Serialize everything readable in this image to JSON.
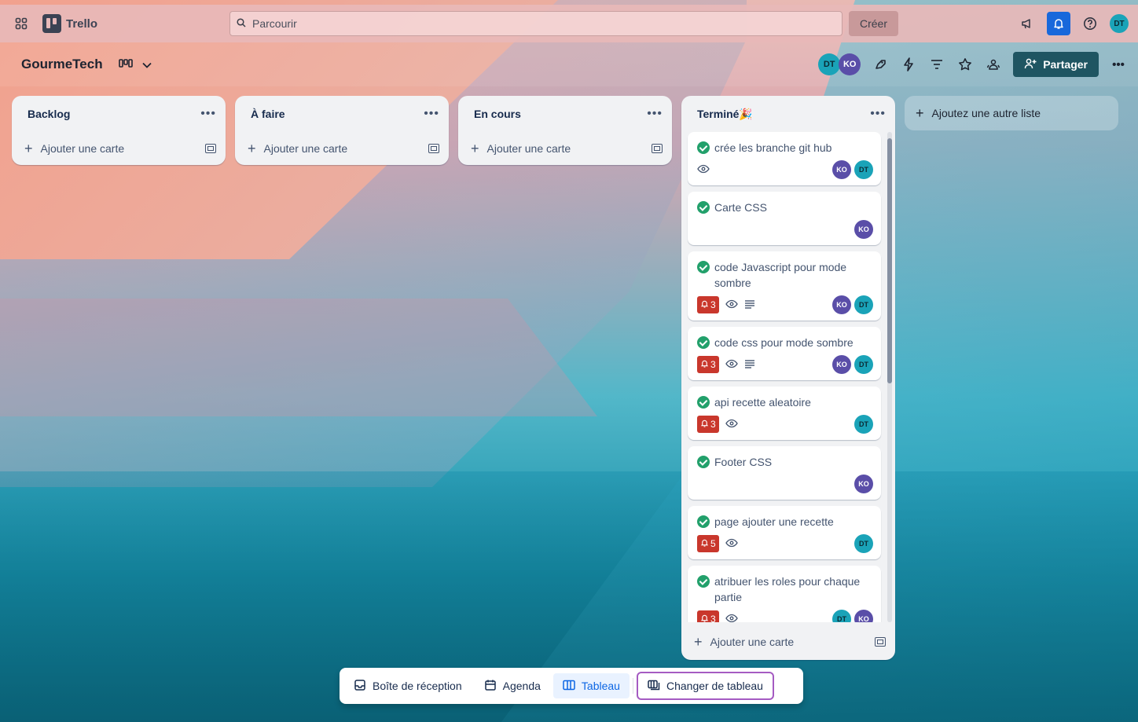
{
  "app": {
    "name": "Trello"
  },
  "topbar": {
    "search_placeholder": "Parcourir",
    "create_label": "Créer",
    "user_initials": "DT"
  },
  "board": {
    "title": "GourmeTech",
    "share_label": "Partager",
    "members": [
      "DT",
      "KO"
    ]
  },
  "lists": [
    {
      "title": "Backlog",
      "add_label": "Ajouter une carte"
    },
    {
      "title": "À faire",
      "add_label": "Ajouter une carte"
    },
    {
      "title": "En cours",
      "add_label": "Ajouter une carte"
    },
    {
      "title": "Terminé🎉",
      "add_label": "Ajouter une carte"
    }
  ],
  "cards": [
    {
      "title": "crée les branche git hub",
      "notifications": "",
      "watch": true,
      "description": false,
      "members": [
        "KO",
        "DT"
      ]
    },
    {
      "title": "Carte CSS",
      "notifications": "",
      "watch": false,
      "description": false,
      "members": [
        "KO"
      ]
    },
    {
      "title": "code Javascript pour mode sombre",
      "notifications": "3",
      "watch": true,
      "description": true,
      "members": [
        "KO",
        "DT"
      ]
    },
    {
      "title": "code css pour mode sombre",
      "notifications": "3",
      "watch": true,
      "description": true,
      "members": [
        "KO",
        "DT"
      ]
    },
    {
      "title": "api recette aleatoire",
      "notifications": "3",
      "watch": true,
      "description": false,
      "members": [
        "DT"
      ]
    },
    {
      "title": "Footer CSS",
      "notifications": "",
      "watch": false,
      "description": false,
      "members": [
        "KO"
      ]
    },
    {
      "title": "page ajouter une recette",
      "notifications": "5",
      "watch": true,
      "description": false,
      "members": [
        "DT"
      ]
    },
    {
      "title": "atribuer les roles pour chaque partie",
      "notifications": "3",
      "watch": true,
      "description": false,
      "members": [
        "DT",
        "KO"
      ]
    }
  ],
  "add_list_label": "Ajoutez une autre liste",
  "bottom_nav": {
    "inbox": "Boîte de réception",
    "agenda": "Agenda",
    "board": "Tableau",
    "switch": "Changer de tableau"
  },
  "colors": {
    "dt_avatar": "#1aa3b8",
    "ko_avatar": "#5a4ea8",
    "share": "#1f5562",
    "badge": "#c9372c",
    "check": "#22a06b"
  }
}
